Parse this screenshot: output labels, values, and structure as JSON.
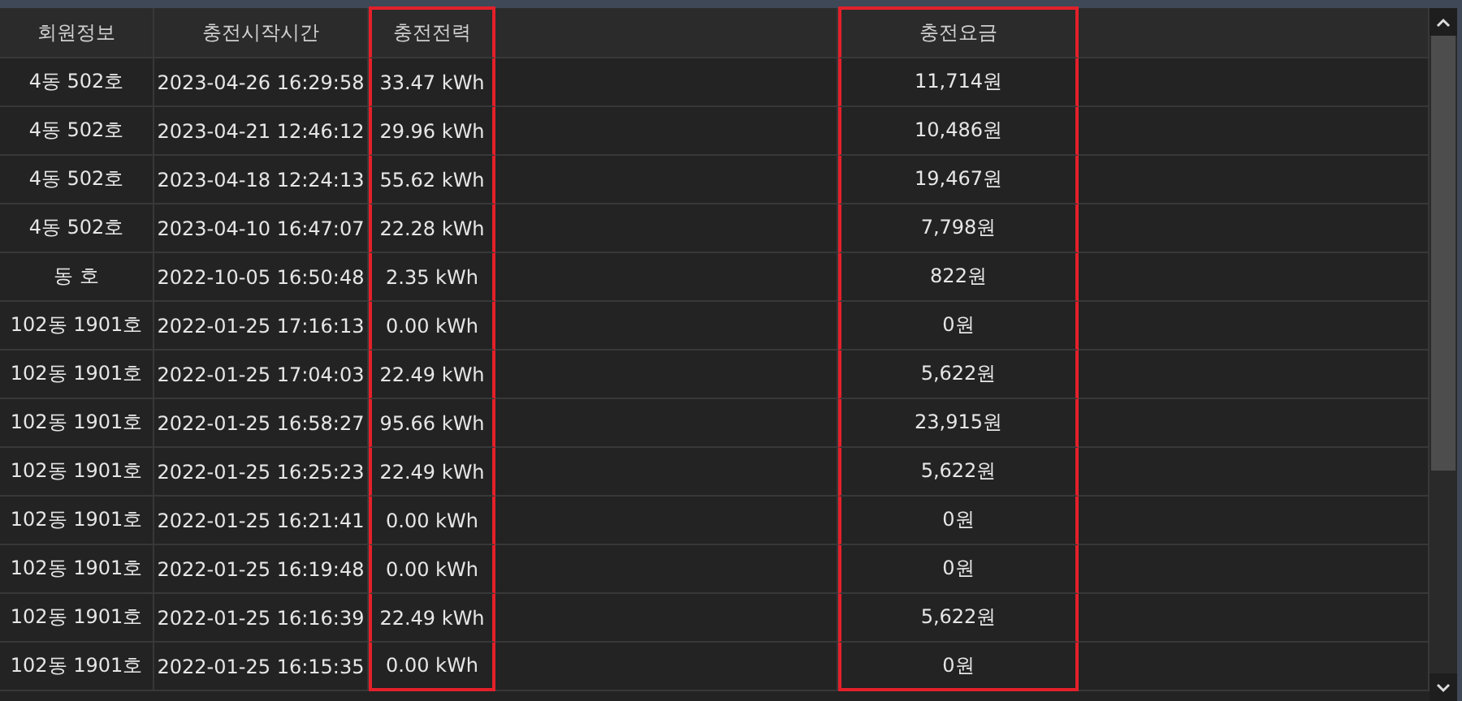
{
  "columns": [
    {
      "kind": "text",
      "label": "회원정보",
      "highlighted": false
    },
    {
      "kind": "text",
      "label": "충전시작시간",
      "highlighted": false
    },
    {
      "kind": "text",
      "label": "충전전력",
      "highlighted": true
    },
    {
      "kind": "blank",
      "highlighted": false
    },
    {
      "kind": "text",
      "label": "충전요금",
      "highlighted": true
    },
    {
      "kind": "blank",
      "highlighted": false
    }
  ],
  "rows": [
    [
      "4동 502호",
      "2023-04-26 16:29:58",
      "33.47 kWh",
      "11,714원"
    ],
    [
      "4동 502호",
      "2023-04-21 12:46:12",
      "29.96 kWh",
      "10,486원"
    ],
    [
      "4동 502호",
      "2023-04-18 12:24:13",
      "55.62 kWh",
      "19,467원"
    ],
    [
      "4동 502호",
      "2023-04-10 16:47:07",
      "22.28 kWh",
      "7,798원"
    ],
    [
      "동 호",
      "2022-10-05 16:50:48",
      "2.35 kWh",
      "822원"
    ],
    [
      "102동 1901호",
      "2022-01-25 17:16:13",
      "0.00 kWh",
      "0원"
    ],
    [
      "102동 1901호",
      "2022-01-25 17:04:03",
      "22.49 kWh",
      "5,622원"
    ],
    [
      "102동 1901호",
      "2022-01-25 16:58:27",
      "95.66 kWh",
      "23,915원"
    ],
    [
      "102동 1901호",
      "2022-01-25 16:25:23",
      "22.49 kWh",
      "5,622원"
    ],
    [
      "102동 1901호",
      "2022-01-25 16:21:41",
      "0.00 kWh",
      "0원"
    ],
    [
      "102동 1901호",
      "2022-01-25 16:19:48",
      "0.00 kWh",
      "0원"
    ],
    [
      "102동 1901호",
      "2022-01-25 16:16:39",
      "22.49 kWh",
      "5,622원"
    ],
    [
      "102동 1901호",
      "2022-01-25 16:15:35",
      "0.00 kWh",
      "0원"
    ]
  ]
}
